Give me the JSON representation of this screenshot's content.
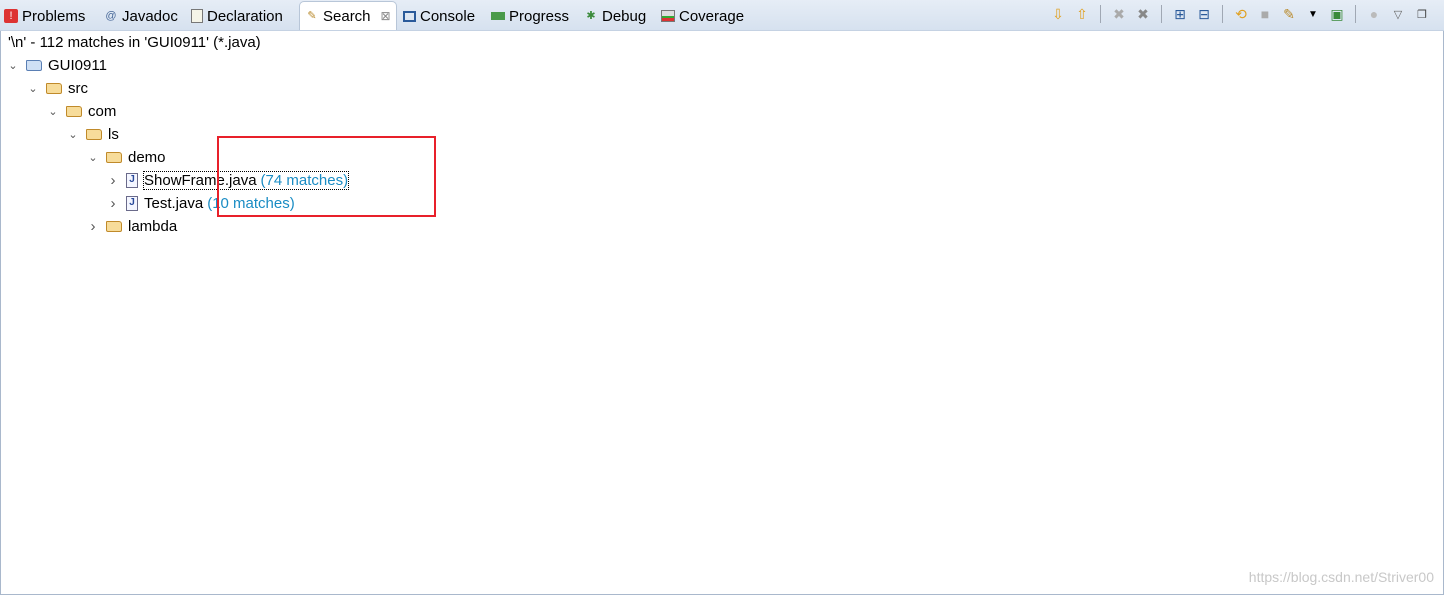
{
  "tabs": [
    {
      "label": "Problems",
      "icon": "problems-icon"
    },
    {
      "label": "Javadoc",
      "icon": "at-icon"
    },
    {
      "label": "Declaration",
      "icon": "declaration-icon"
    },
    {
      "label": "Search",
      "icon": "search-flashlight-icon",
      "active": true,
      "close": "⊠"
    },
    {
      "label": "Console",
      "icon": "console-icon"
    },
    {
      "label": "Progress",
      "icon": "progress-icon"
    },
    {
      "label": "Debug",
      "icon": "debug-icon"
    },
    {
      "label": "Coverage",
      "icon": "coverage-icon"
    }
  ],
  "toolbar": [
    "next-match-icon",
    "previous-match-icon",
    "remove-selected-icon",
    "remove-all-icon",
    "expand-all-icon",
    "collapse-all-icon",
    "refresh-icon",
    "cancel-icon",
    "search-history-icon",
    "dropdown-icon",
    "pin-icon",
    "group-icon",
    "view-menu-icon",
    "minimize-icon"
  ],
  "summary": "'\\n' - 112 matches in 'GUI0911' (*.java)",
  "tree": [
    {
      "label": "GUI0911",
      "type": "project",
      "expanded": true,
      "level": 0
    },
    {
      "label": "src",
      "type": "folder",
      "expanded": true,
      "level": 1
    },
    {
      "label": "com",
      "type": "folder",
      "expanded": true,
      "level": 2
    },
    {
      "label": "ls",
      "type": "folder",
      "expanded": true,
      "level": 3
    },
    {
      "label": "demo",
      "type": "folder",
      "expanded": true,
      "level": 4
    },
    {
      "label": "ShowFrame.java",
      "count": "(74 matches)",
      "type": "java",
      "expanded": false,
      "level": 5,
      "selected": true
    },
    {
      "label": "Test.java",
      "count": "(10 matches)",
      "type": "java",
      "expanded": false,
      "level": 5
    },
    {
      "label": "lambda",
      "type": "folder",
      "expanded": false,
      "level": 4
    }
  ],
  "watermark": "https://blog.csdn.net/Striver00",
  "colors": {
    "highlight_box": "#e8202a",
    "match_count": "#1a8cc4"
  }
}
